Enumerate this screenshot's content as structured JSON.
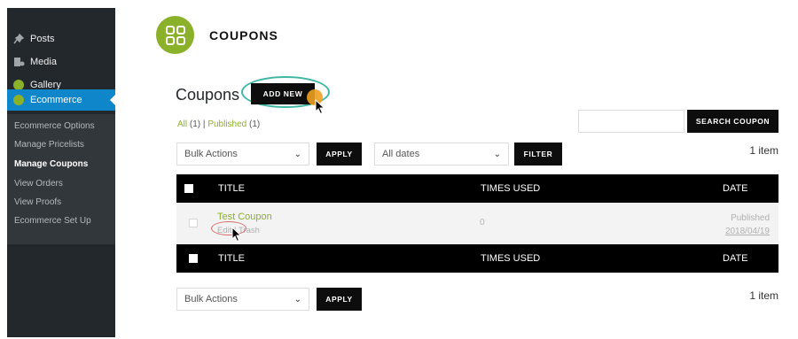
{
  "sidebar": {
    "items": [
      {
        "label": "Posts",
        "icon": "pin-icon"
      },
      {
        "label": "Media",
        "icon": "media-icon"
      },
      {
        "label": "Gallery",
        "icon": "gallery-icon"
      },
      {
        "label": "Ecommerce",
        "icon": "ecommerce-icon",
        "active": true
      }
    ],
    "submenu": [
      {
        "label": "Ecommerce Options"
      },
      {
        "label": "Manage Pricelists"
      },
      {
        "label": "Manage Coupons",
        "current": true
      },
      {
        "label": "View Orders"
      },
      {
        "label": "View Proofs"
      },
      {
        "label": "Ecommerce Set Up"
      }
    ],
    "colors": {
      "background": "#23282d",
      "active": "#0e86c9"
    }
  },
  "header": {
    "title": "COUPONS",
    "logo_color": "#8bb02a"
  },
  "page": {
    "title": "Coupons",
    "add_new_label": "ADD NEW"
  },
  "filters": {
    "all_label": "All",
    "all_count": "(1)",
    "separator": "|",
    "published_label": "Published",
    "published_count": "(1)"
  },
  "search": {
    "button_label": "SEARCH COUPON",
    "value": ""
  },
  "top_nav": {
    "bulk_actions": "Bulk Actions",
    "apply_label": "APPLY",
    "dates": "All dates",
    "filter_label": "FILTER",
    "item_count": "1 item"
  },
  "table": {
    "columns": [
      "TITLE",
      "TIMES USED",
      "DATE"
    ],
    "rows": [
      {
        "title": "Test Coupon",
        "actions": {
          "edit": "Edit",
          "separator": "|",
          "trash": "Trash"
        },
        "times_used": "0",
        "status": "Published",
        "date": "2018/04/19"
      }
    ]
  },
  "bottom_nav": {
    "bulk_actions": "Bulk Actions",
    "apply_label": "APPLY",
    "item_count": "1 item"
  }
}
